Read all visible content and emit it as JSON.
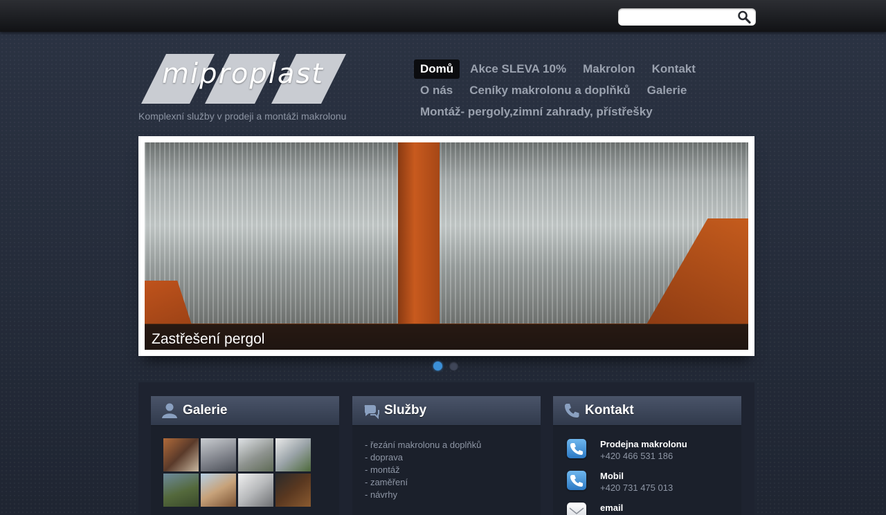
{
  "search": {
    "placeholder": "",
    "value": ""
  },
  "logo": {
    "text": "miproplast"
  },
  "tagline": "Komplexní služby v prodeji a montáži makrolonu",
  "nav": {
    "rows": [
      [
        "Domů",
        "Akce SLEVA 10%",
        "Makrolon",
        "Kontakt"
      ],
      [
        "O nás",
        "Ceníky makrolonu a doplňků",
        "Galerie"
      ],
      [
        "Montáž- pergoly,zimní zahrady, přístřešky"
      ]
    ],
    "active": "Domů"
  },
  "slider": {
    "caption": "Zastřešení pergol",
    "slide_count": 2,
    "active_slide": 1
  },
  "boxes": {
    "gallery": {
      "title": "Galerie"
    },
    "services": {
      "title": "Služby",
      "items": [
        "- řezání makrolonu a doplňků",
        "- doprava",
        "- montáž",
        "- zaměření",
        "- návrhy"
      ]
    },
    "contact": {
      "title": "Kontakt",
      "items": [
        {
          "label": "Prodejna makrolonu",
          "value": "+420 466 531 186",
          "icon": "phone-icon"
        },
        {
          "label": "Mobil",
          "value": "+420 731 475 013",
          "icon": "phone-icon"
        },
        {
          "label": "email",
          "value": "",
          "icon": "mail-icon"
        }
      ]
    }
  },
  "colors": {
    "accent": "#3b8fd6",
    "nav_active_bg": "#0b0c0f"
  }
}
